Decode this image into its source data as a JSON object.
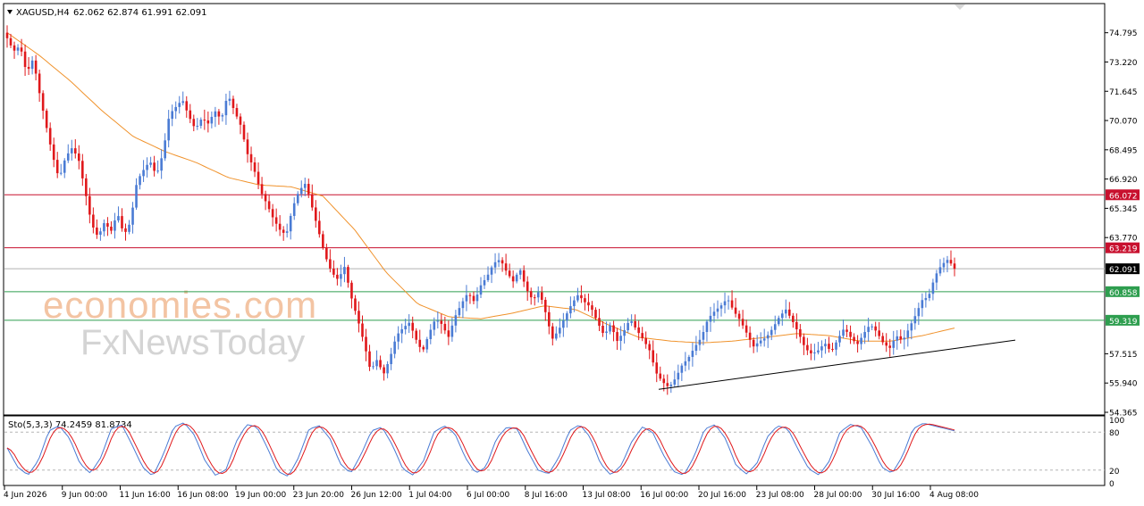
{
  "header": {
    "symbol": "XAGUSD,H4",
    "ohlc": "62.062 62.874 61.991 62.091"
  },
  "oscillator": {
    "label": "Sto(5,3,3) 74.2459 81.8734",
    "levels": [
      100,
      80,
      20,
      0
    ]
  },
  "watermark": {
    "line1": "economies.com",
    "line2": "FxNewsToday"
  },
  "colors": {
    "bull": "#4a7bd4",
    "bear": "#e0181b",
    "ma": "#f0922b",
    "resistance": "#c8102e",
    "support": "#2e9e4f",
    "current": "#b0b0b0",
    "trendline": "#000000"
  },
  "chart_data": {
    "type": "candlestick",
    "ylim": [
      54.365,
      75.5
    ],
    "price_ticks": [
      "74.795",
      "73.220",
      "71.645",
      "70.070",
      "68.495",
      "66.920",
      "65.345",
      "63.770",
      "62.195",
      "60.620",
      "59.045",
      "57.515",
      "55.940",
      "54.365"
    ],
    "x_labels": [
      "4 Jun 2026",
      "9 Jun 00:00",
      "11 Jun 16:00",
      "16 Jun 08:00",
      "19 Jun 00:00",
      "23 Jun 20:00",
      "26 Jun 12:00",
      "1 Jul 04:00",
      "6 Jul 00:00",
      "8 Jul 16:00",
      "13 Jul 08:00",
      "16 Jul 00:00",
      "20 Jul 16:00",
      "23 Jul 08:00",
      "28 Jul 00:00",
      "30 Jul 16:00",
      "4 Aug 08:00"
    ],
    "levels": [
      {
        "name": "resistance-2",
        "value": 66.072,
        "label": "66.072",
        "kind": "resistance"
      },
      {
        "name": "resistance-1",
        "value": 63.219,
        "label": "63.219",
        "kind": "resistance"
      },
      {
        "name": "current-price",
        "value": 62.091,
        "label": "62.091",
        "kind": "current"
      },
      {
        "name": "support-1",
        "value": 60.858,
        "label": "60.858",
        "kind": "support"
      },
      {
        "name": "support-2",
        "value": 59.319,
        "label": "59.319",
        "kind": "support"
      }
    ],
    "close_path": [
      74.5,
      73.8,
      74.1,
      72.6,
      73.4,
      71.5,
      69.8,
      68.2,
      66.9,
      68.1,
      68.6,
      68.0,
      66.3,
      64.5,
      63.8,
      64.6,
      64.1,
      65.1,
      63.9,
      64.6,
      66.8,
      67.4,
      67.9,
      67.1,
      68.3,
      70.4,
      70.8,
      71.2,
      70.3,
      69.6,
      70.2,
      69.9,
      70.6,
      70.1,
      71.5,
      70.6,
      69.8,
      68.3,
      67.5,
      66.3,
      65.6,
      64.8,
      64.2,
      63.9,
      65.4,
      66.3,
      66.7,
      65.4,
      64.1,
      62.8,
      61.9,
      61.5,
      62.2,
      60.6,
      59.4,
      58.1,
      56.6,
      57.2,
      56.4,
      57.3,
      58.5,
      58.9,
      59.2,
      58.3,
      57.6,
      58.6,
      59.4,
      59.1,
      58.4,
      59.5,
      60.2,
      60.8,
      60.3,
      61.2,
      61.7,
      62.4,
      62.6,
      61.9,
      61.4,
      62.1,
      61.0,
      60.4,
      60.9,
      59.7,
      58.3,
      58.8,
      59.5,
      60.2,
      60.7,
      60.3,
      60.0,
      59.2,
      58.5,
      59.1,
      58.2,
      58.7,
      59.4,
      58.8,
      58.3,
      57.7,
      56.5,
      56.0,
      55.7,
      56.2,
      56.9,
      57.3,
      57.9,
      58.4,
      59.4,
      59.8,
      60.1,
      60.5,
      59.8,
      59.3,
      58.6,
      57.9,
      58.2,
      58.4,
      58.9,
      59.5,
      59.9,
      59.3,
      58.6,
      57.8,
      57.5,
      57.7,
      58.1,
      57.6,
      58.3,
      58.9,
      58.4,
      58.0,
      58.6,
      59.1,
      58.7,
      58.1,
      57.8,
      58.5,
      58.2,
      58.9,
      59.6,
      60.4,
      60.6,
      61.7,
      62.3,
      62.6,
      62.091
    ],
    "ma_path": [
      74.8,
      73.6,
      72.2,
      70.6,
      69.2,
      68.4,
      67.8,
      67.0,
      66.6,
      66.5,
      66.0,
      64.2,
      61.9,
      60.2,
      59.5,
      59.4,
      59.7,
      60.1,
      59.9,
      59.1,
      58.4,
      58.2,
      58.1,
      58.2,
      58.4,
      58.6,
      58.5,
      58.2,
      58.2,
      58.5,
      58.9
    ],
    "trendline": [
      {
        "x": "16 Jul 00:00",
        "y": 55.6
      },
      {
        "x": "end",
        "y": 58.25
      }
    ],
    "stoch_path": [
      55,
      25,
      12,
      35,
      82,
      90,
      70,
      30,
      15,
      40,
      85,
      92,
      60,
      25,
      10,
      45,
      88,
      95,
      75,
      35,
      12,
      20,
      65,
      92,
      88,
      55,
      18,
      10,
      40,
      85,
      90,
      70,
      30,
      15,
      45,
      82,
      88,
      60,
      22,
      12,
      35,
      80,
      90,
      78,
      40,
      15,
      25,
      70,
      88,
      85,
      50,
      20,
      14,
      40,
      82,
      92,
      72,
      30,
      12,
      28,
      65,
      88,
      80,
      45,
      18,
      12,
      42,
      85,
      92,
      70,
      28,
      14,
      30,
      72,
      90,
      85,
      52,
      22,
      12,
      35,
      80,
      92,
      88,
      60,
      25,
      15,
      42,
      85,
      94,
      90,
      86,
      82
    ]
  }
}
